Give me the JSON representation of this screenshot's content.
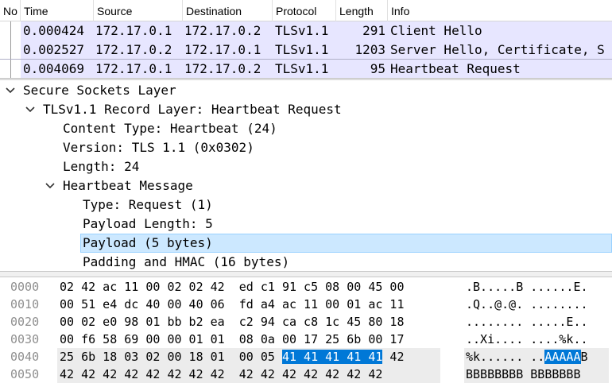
{
  "packet_list": {
    "columns": {
      "no": "No",
      "time": "Time",
      "source": "Source",
      "destination": "Destination",
      "protocol": "Protocol",
      "length": "Length",
      "info": "Info"
    },
    "rows": [
      {
        "time": "0.000424",
        "source": "172.17.0.1",
        "destination": "172.17.0.2",
        "protocol": "TLSv1.1",
        "length": "291",
        "info": "Client Hello"
      },
      {
        "time": "0.002527",
        "source": "172.17.0.2",
        "destination": "172.17.0.1",
        "protocol": "TLSv1.1",
        "length": "1203",
        "info": "Server Hello, Certificate, S"
      },
      {
        "time": "0.004069",
        "source": "172.17.0.1",
        "destination": "172.17.0.2",
        "protocol": "TLSv1.1",
        "length": "95",
        "info": "Heartbeat Request"
      }
    ]
  },
  "detail_tree": [
    {
      "label": "Secure Sockets Layer"
    },
    {
      "label": "TLSv1.1 Record Layer: Heartbeat Request"
    },
    {
      "label": "Content Type: Heartbeat (24)"
    },
    {
      "label": "Version: TLS 1.1 (0x0302)"
    },
    {
      "label": "Length: 24"
    },
    {
      "label": "Heartbeat Message"
    },
    {
      "label": "Type: Request (1)"
    },
    {
      "label": "Payload Length: 5"
    },
    {
      "label": "Payload (5 bytes)"
    },
    {
      "label": "Padding and HMAC (16 bytes)"
    }
  ],
  "hex_dump": [
    {
      "offset": "0000",
      "bytes": "02 42 ac 11 00 02 02 42  ed c1 91 c5 08 00 45 00",
      "ascii": ".B.....B ......E."
    },
    {
      "offset": "0010",
      "bytes": "00 51 e4 dc 40 00 40 06  fd a4 ac 11 00 01 ac 11",
      "ascii": ".Q..@.@. ........"
    },
    {
      "offset": "0020",
      "bytes": "00 02 e0 98 01 bb b2 ea  c2 94 ca c8 1c 45 80 18",
      "ascii": "........ .....E.."
    },
    {
      "offset": "0030",
      "bytes": "00 f6 58 69 00 00 01 01  08 0a 00 17 25 6b 00 17",
      "ascii": "..Xi.... ....%k.."
    },
    {
      "offset": "0040",
      "bytes_pre": "25 6b 18 03 02 00 18 01  00 05 ",
      "bytes_sel": "41 41 41 41 41",
      "bytes_post": " 42",
      "ascii_pre": "%k...... ..",
      "ascii_sel": "AAAAA",
      "ascii_post": "B"
    },
    {
      "offset": "0050",
      "bytes": "42 42 42 42 42 42 42 42  42 42 42 42 42 42 42",
      "ascii": "BBBBBBBB BBBBBBB"
    }
  ],
  "colors": {
    "tls_row_bg": "#e7e6ff",
    "tree_selection_bg": "#cce8ff",
    "hex_selection_bg": "#0078d7"
  }
}
